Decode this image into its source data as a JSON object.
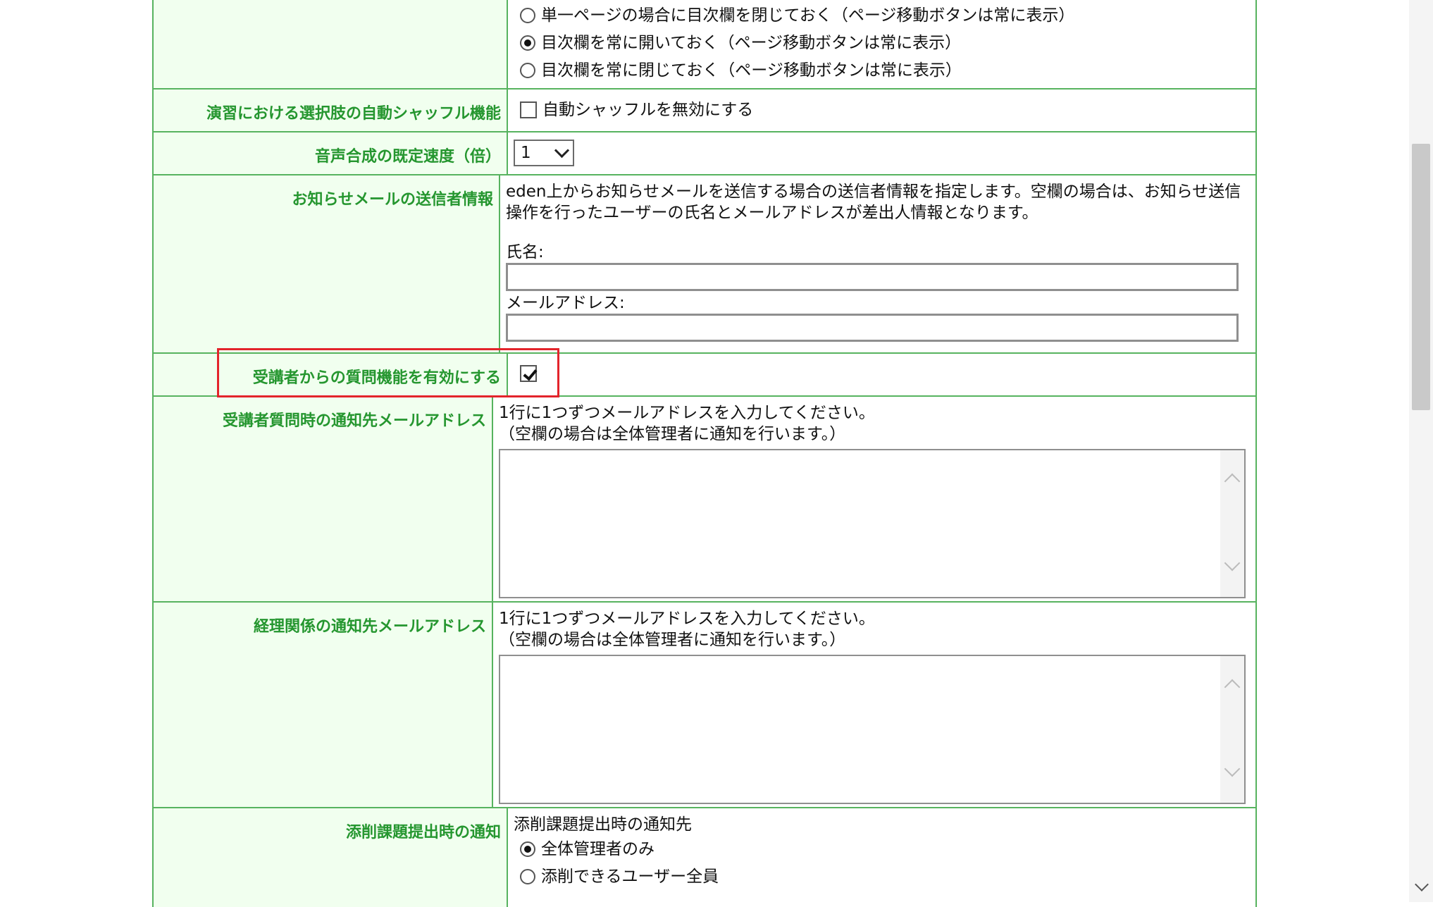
{
  "toc": {
    "options": [
      {
        "label": "単一ページの場合に目次欄を閉じておく（ページ移動ボタンは常に表示）",
        "checked": false
      },
      {
        "label": "目次欄を常に開いておく（ページ移動ボタンは常に表示）",
        "checked": true
      },
      {
        "label": "目次欄を常に閉じておく（ページ移動ボタンは常に表示）",
        "checked": false
      }
    ]
  },
  "shuffle": {
    "label": "演習における選択肢の自動シャッフル機能",
    "checkbox_label": "自動シャッフルを無効にする",
    "checked": false
  },
  "speech": {
    "label": "音声合成の既定速度（倍）",
    "value": "1"
  },
  "sender": {
    "label": "お知らせメールの送信者情報",
    "description": "eden上からお知らせメールを送信する場合の送信者情報を指定します。空欄の場合は、お知らせ送信操作を行ったユーザーの氏名とメールアドレスが差出人情報となります。",
    "name_label": "氏名:",
    "name_value": "",
    "email_label": "メールアドレス:",
    "email_value": ""
  },
  "questions": {
    "label": "受講者からの質問機能を有効にする",
    "checked": true
  },
  "question_mail": {
    "label": "受講者質問時の通知先メールアドレス",
    "hint1": "1行に1つずつメールアドレスを入力してください。",
    "hint2": "（空欄の場合は全体管理者に通知を行います。）",
    "value": ""
  },
  "accounting_mail": {
    "label": "経理関係の通知先メールアドレス",
    "hint1": "1行に1つずつメールアドレスを入力してください。",
    "hint2": "（空欄の場合は全体管理者に通知を行います。）",
    "value": ""
  },
  "correction": {
    "label": "添削課題提出時の通知",
    "sub_label": "添削課題提出時の通知先",
    "options": [
      {
        "label": "全体管理者のみ",
        "checked": true
      },
      {
        "label": "添削できるユーザー全員",
        "checked": false
      }
    ]
  },
  "colors": {
    "accent_green": "#25962f",
    "border_green": "#57b35f",
    "label_bg": "#f1ffef",
    "highlight_red": "#e3242b"
  }
}
